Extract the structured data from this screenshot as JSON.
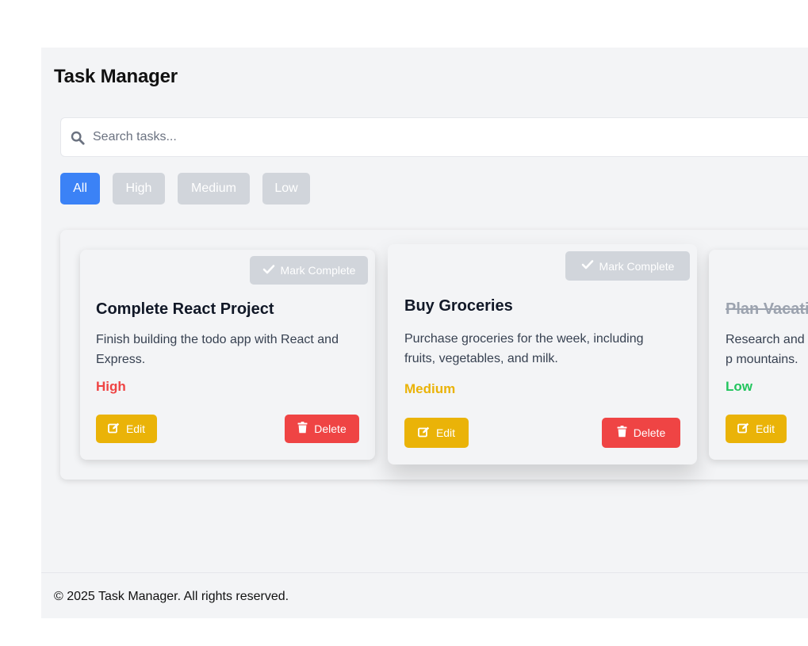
{
  "app": {
    "title": "Task Manager"
  },
  "search": {
    "placeholder": "Search tasks...",
    "value": ""
  },
  "filters": [
    {
      "label": "All",
      "active": true
    },
    {
      "label": "High",
      "active": false
    },
    {
      "label": "Medium",
      "active": false
    },
    {
      "label": "Low",
      "active": false
    }
  ],
  "tasks": [
    {
      "title": "Complete React Project",
      "description": "Finish building the todo app with React and Express.",
      "priority": "High",
      "priority_color": "#ef4444",
      "completed": false,
      "mark_label": "Mark Complete",
      "edit_label": "Edit",
      "delete_label": "Delete"
    },
    {
      "title": "Buy Groceries",
      "description": "Purchase groceries for the week, including fruits, vegetables, and milk.",
      "priority": "Medium",
      "priority_color": "#eab308",
      "completed": false,
      "mark_label": "Mark Complete",
      "edit_label": "Edit",
      "delete_label": "Delete"
    },
    {
      "title": "Plan Vacatio",
      "description": "Research and p mountains.",
      "priority": "Low",
      "priority_color": "#22c55e",
      "completed": true,
      "edit_label": "Edit"
    }
  ],
  "footer": {
    "text": "© 2025 Task Manager. All rights reserved."
  },
  "colors": {
    "accent": "#3b82f6",
    "edit": "#eab308",
    "delete": "#ef4444",
    "inactive": "#d1d5db"
  },
  "icons": {
    "search": "search-icon",
    "check": "check-icon",
    "edit": "edit-icon",
    "delete": "trash-icon"
  }
}
